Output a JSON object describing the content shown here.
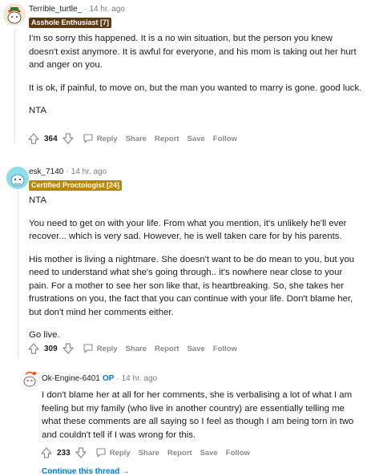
{
  "comments": [
    {
      "username": "Terrible_turtle_",
      "age": "14 hr. ago",
      "flair": "Asshole Enthusiast [7]",
      "flair_color": "#5c3a14",
      "paragraphs": [
        "I'm so sorry this happened. It is a no win situation, but the person you knew doesn't exist anymore. It is awful for everyone, and his mom is taking out her hurt and anger on you.",
        "It is ok, if painful, to move on, but the man you wanted to marry is gone. good luck.",
        "NTA"
      ],
      "score": "364",
      "actions": {
        "reply": "Reply",
        "share": "Share",
        "report": "Report",
        "save": "Save",
        "follow": "Follow"
      }
    },
    {
      "username": "esk_7140",
      "age": "14 hr. ago",
      "flair": "Certified Proctologist [24]",
      "flair_color": "#b8860b",
      "paragraphs": [
        "NTA",
        "You need to get on with your life. From what you mention, it's unlikely he'll ever recover... which is very sad. However, he is well taken care for by his parents.",
        "His mother is living a nightmare. She doesn't want to be do mean to you, but you need to understand what she's going through.. it's nowhere near close to your pain. For a mother to see her son like that, is heartbreaking. So, she takes her frustrations on you, the fact that you can continue with your life. Don't blame her, but don't mind her comments either.",
        "Go live."
      ],
      "score": "309",
      "actions": {
        "reply": "Reply",
        "share": "Share",
        "report": "Report",
        "save": "Save",
        "follow": "Follow"
      }
    },
    {
      "username": "Ok-Engine-6401",
      "op_badge": "OP",
      "age": "14 hr. ago",
      "paragraphs": [
        "I don't blame her at all for her comments, she is verbalising a lot of what I am feeling but my family (who live in another country) are essentially telling me what these comments are all saying so I feel as though I am being torn in two and couldn't tell if I was wrong for this."
      ],
      "score": "233",
      "actions": {
        "reply": "Reply",
        "share": "Share",
        "report": "Report",
        "save": "Save",
        "follow": "Follow"
      }
    }
  ],
  "continue_thread": "Continue this thread →",
  "meta_separator": "·",
  "icons": {
    "upvote": "upvote-icon",
    "downvote": "downvote-icon",
    "reply": "reply-icon"
  }
}
